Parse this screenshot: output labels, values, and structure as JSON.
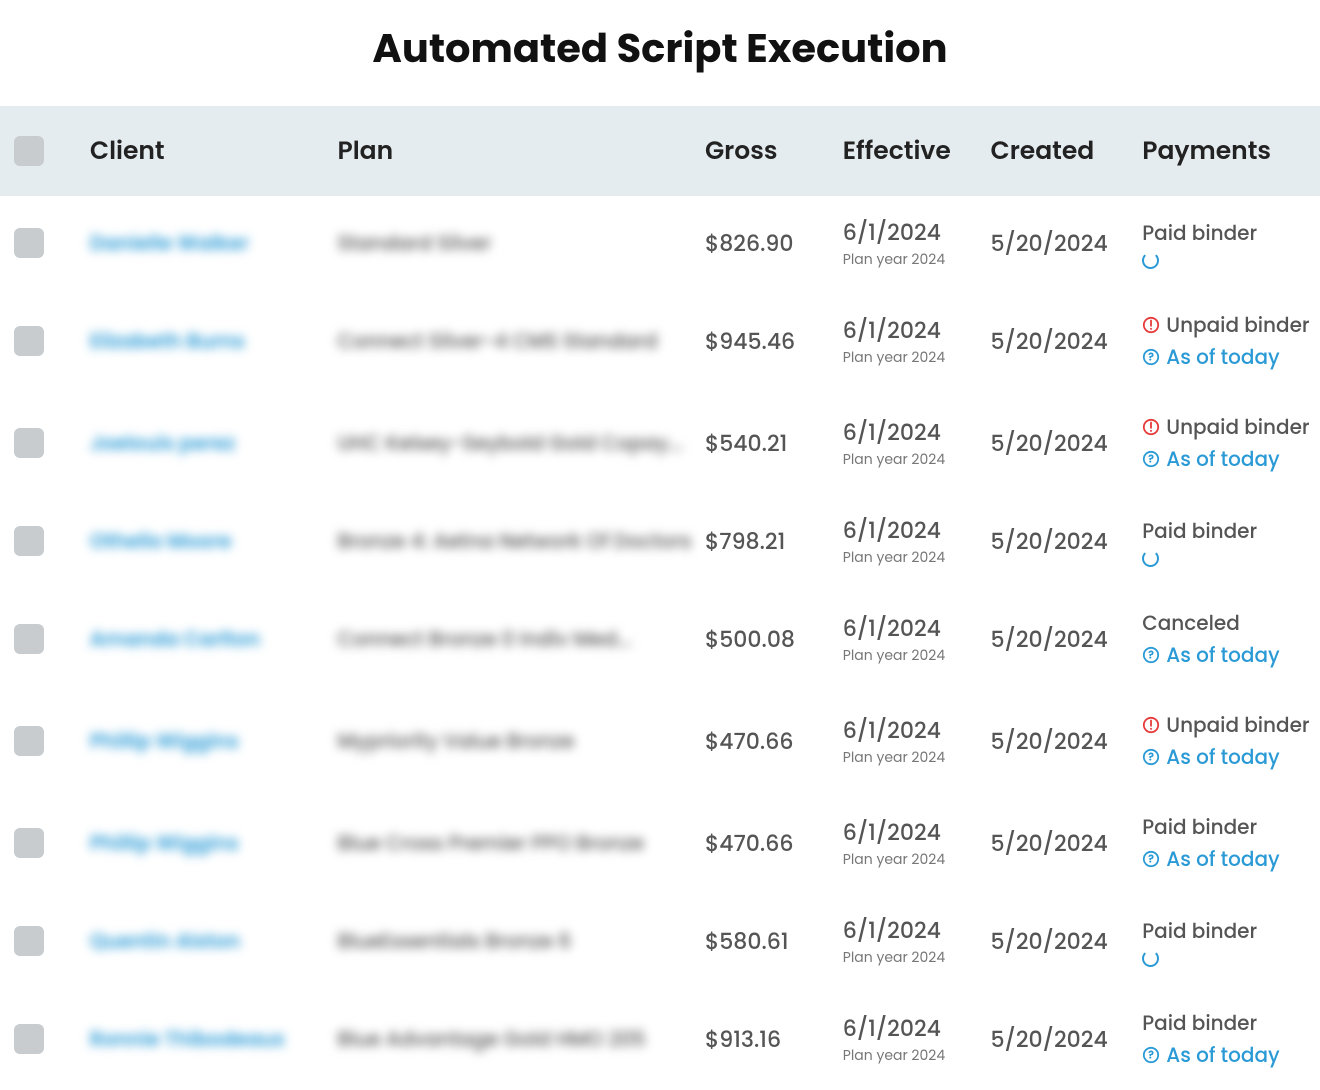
{
  "title": "Automated Script Execution",
  "columns": {
    "client": "Client",
    "plan": "Plan",
    "gross": "Gross",
    "effective": "Effective",
    "created": "Created",
    "payments": "Payments"
  },
  "plan_year_label": "Plan year 2024",
  "as_of_today": "As of today",
  "statuses": {
    "paid": "Paid binder",
    "unpaid": "Unpaid binder",
    "canceled": "Canceled"
  },
  "rows": [
    {
      "client": "Danielle Walker",
      "plan": "Standard Silver",
      "gross": "$826.90",
      "effective": "6/1/2024",
      "created": "5/20/2024",
      "status": "paid",
      "spinner": true,
      "asof": false
    },
    {
      "client": "Elizabeth Burns",
      "plan": "Connect Silver-4 CMS Standard",
      "gross": "$945.46",
      "effective": "6/1/2024",
      "created": "5/20/2024",
      "status": "unpaid",
      "spinner": false,
      "asof": true
    },
    {
      "client": "Joelouis perez",
      "plan": "UHC Kelsey-Seybold Gold Copay...",
      "gross": "$540.21",
      "effective": "6/1/2024",
      "created": "5/20/2024",
      "status": "unpaid",
      "spinner": false,
      "asof": true
    },
    {
      "client": "Othello Moore",
      "plan": "Bronze 4: Aetna Network Of Doctors",
      "gross": "$798.21",
      "effective": "6/1/2024",
      "created": "5/20/2024",
      "status": "paid",
      "spinner": true,
      "asof": false
    },
    {
      "client": "Amanda Carlton",
      "plan": "Connect Bronze 0 Indiv Med...",
      "gross": "$500.08",
      "effective": "6/1/2024",
      "created": "5/20/2024",
      "status": "canceled",
      "spinner": false,
      "asof": true
    },
    {
      "client": "Phillip Wiggins",
      "plan": "Mypriority Value Bronze",
      "gross": "$470.66",
      "effective": "6/1/2024",
      "created": "5/20/2024",
      "status": "unpaid",
      "spinner": false,
      "asof": true
    },
    {
      "client": "Phillip Wiggins",
      "plan": "Blue Cross Premier PPO Bronze",
      "gross": "$470.66",
      "effective": "6/1/2024",
      "created": "5/20/2024",
      "status": "paid",
      "spinner": false,
      "asof": true
    },
    {
      "client": "Quentin Alston",
      "plan": "BlueEssentials Bronze 6",
      "gross": "$580.61",
      "effective": "6/1/2024",
      "created": "5/20/2024",
      "status": "paid",
      "spinner": true,
      "asof": false
    },
    {
      "client": "Ronnie Thibodeaux",
      "plan": "Blue Advantage Gold HMO 205",
      "gross": "$913.16",
      "effective": "6/1/2024",
      "created": "5/20/2024",
      "status": "paid",
      "spinner": false,
      "asof": true
    }
  ]
}
